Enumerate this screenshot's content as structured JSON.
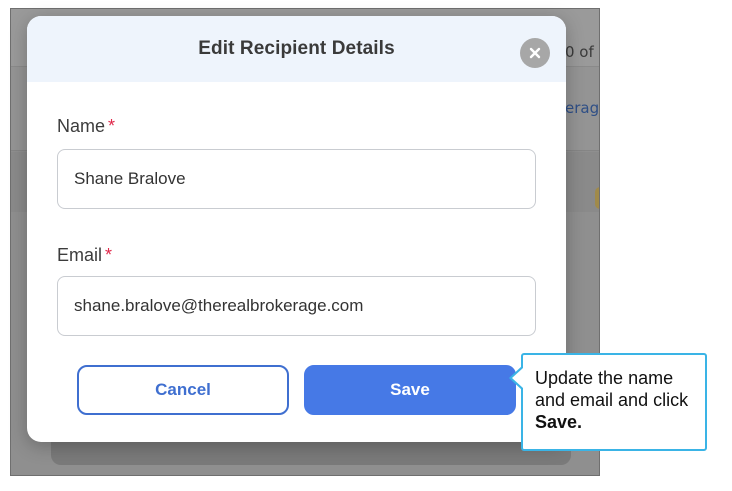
{
  "background": {
    "partial_text_top": "0 of",
    "partial_text_link": "erag"
  },
  "modal": {
    "title": "Edit Recipient Details",
    "close_icon": "close-icon",
    "name_field": {
      "label": "Name",
      "required_mark": "*",
      "value": "Shane Bralove"
    },
    "email_field": {
      "label": "Email",
      "required_mark": "*",
      "value": "shane.bralove@therealbrokerage.com"
    },
    "cancel_label": "Cancel",
    "save_label": "Save"
  },
  "callout": {
    "text_prefix": "Update the name and email and click ",
    "text_bold": "Save."
  },
  "colors": {
    "accent": "#4679e6",
    "required": "#e0284a",
    "callout_border": "#3ab4e6",
    "header_bg": "#eef4fc"
  }
}
